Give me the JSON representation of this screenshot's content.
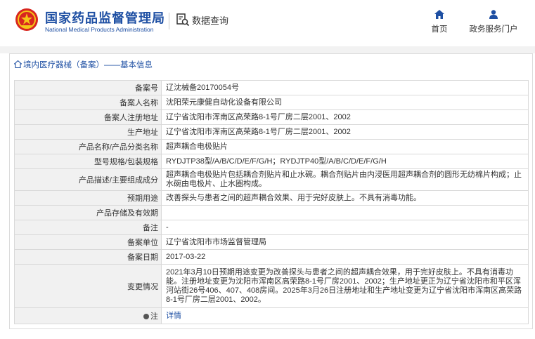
{
  "header": {
    "brand_cn": "国家药品监督管理局",
    "brand_en": "National Medical Products Administration",
    "query_label": "数据查询",
    "nav_home": "首页",
    "nav_portal": "政务服务门户",
    "brand_color": "#1e4fa3",
    "logo_color": "#d8261f"
  },
  "breadcrumb": {
    "text": "境内医疗器械（备案）——基本信息"
  },
  "rows": [
    {
      "label": "备案号",
      "value": "辽沈械备20170054号"
    },
    {
      "label": "备案人名称",
      "value": "沈阳荣元康健自动化设备有限公司"
    },
    {
      "label": "备案人注册地址",
      "value": "辽宁省沈阳市浑南区高荣路8-1号厂房二层2001、2002"
    },
    {
      "label": "生产地址",
      "value": "辽宁省沈阳市浑南区高荣路8-1号厂房二层2001、2002"
    },
    {
      "label": "产品名称/产品分类名称",
      "value": "超声耦合电极贴片"
    },
    {
      "label": "型号规格/包装规格",
      "value": "RYDJTP38型/A/B/C/D/E/F/G/H；RYDJTP40型/A/B/C/D/E/F/G/H"
    },
    {
      "label": "产品描述/主要组成成分",
      "value": "超声耦合电极贴片包括耦合剂贴片和止水碗。耦合剂贴片由内浸医用超声耦合剂的圆形无纺棉片构成；止水碗由电极片、止水圈构成。"
    },
    {
      "label": "预期用途",
      "value": "改善探头与患者之间的超声耦合效果、用于完好皮肤上。不具有消毒功能。"
    },
    {
      "label": "产品存储及有效期",
      "value": ""
    },
    {
      "label": "备注",
      "value": "-"
    },
    {
      "label": "备案单位",
      "value": "辽宁省沈阳市市场监督管理局"
    },
    {
      "label": "备案日期",
      "value": "2017-03-22"
    },
    {
      "label": "变更情况",
      "value": "2021年3月10日预期用途变更为改善探头与患者之间的超声耦合效果，用于完好皮肤上。不具有消毒功能。注册地址变更为沈阳市浑南区高荣路8-1号厂房2001、2002；生产地址更正为辽宁省沈阳市和平区浑河站街26号406、407、408房间。2025年3月26日注册地址和生产地址变更为辽宁省沈阳市浑南区高荣路8-1号厂房二层2001、2002。"
    },
    {
      "label": "注",
      "value": "详情"
    }
  ]
}
